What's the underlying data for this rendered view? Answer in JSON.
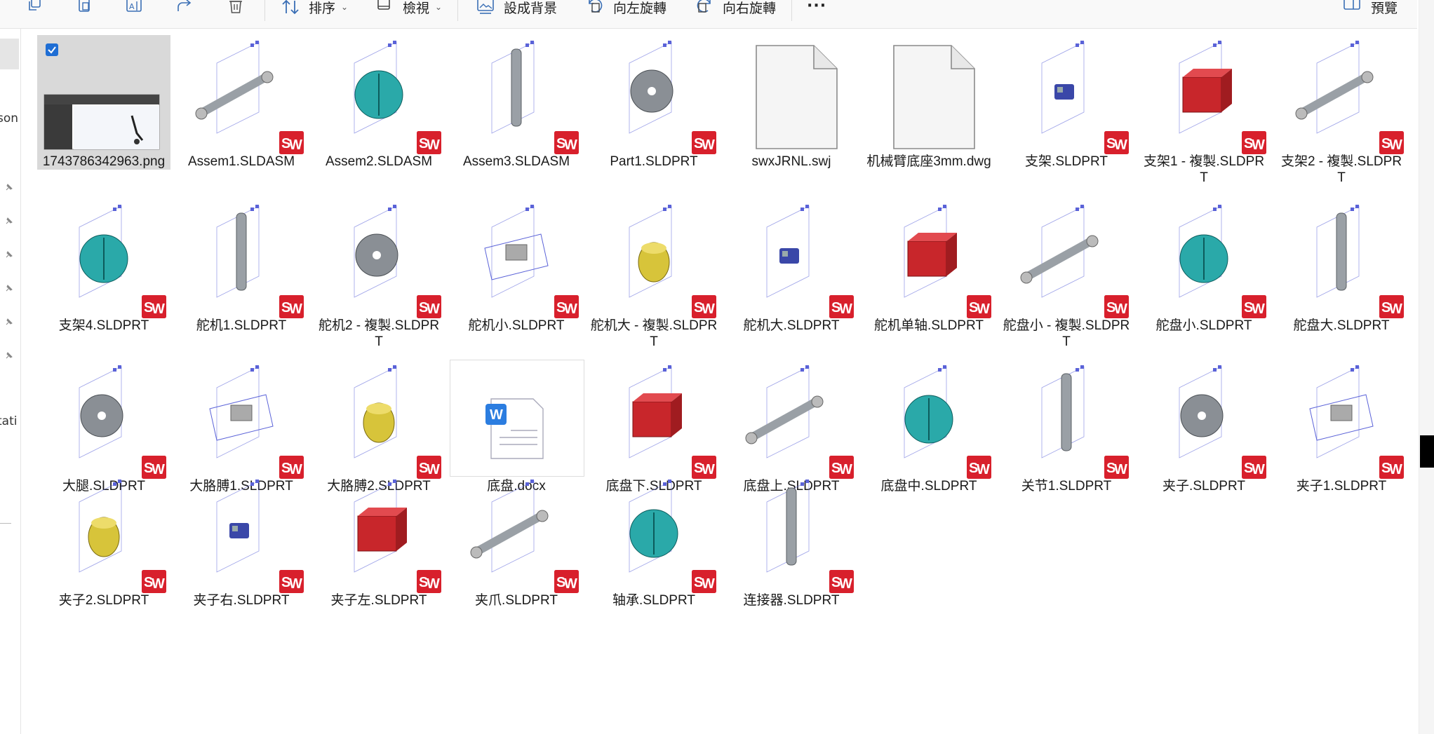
{
  "toolbar": {
    "sort_label": "排序",
    "view_label": "檢視",
    "set_background_label": "設成背景",
    "rotate_left_label": "向左旋轉",
    "rotate_right_label": "向右旋轉",
    "more_label": "···",
    "preview_label": "預覽",
    "icons": [
      "copy-icon",
      "paste-icon",
      "rename-icon",
      "share-icon",
      "delete-icon",
      "sort-icon",
      "view-icon",
      "set-background-icon",
      "rotate-left-icon",
      "rotate-right-icon",
      "more-icon",
      "preview-pane-icon"
    ]
  },
  "sidebar": {
    "partial_labels": [
      "son",
      "tati"
    ]
  },
  "files": [
    {
      "name": "1743786342963.png",
      "icon": "image-thumbnail",
      "selected": true
    },
    {
      "name": "Assem1.SLDASM",
      "icon": "solidworks-assembly"
    },
    {
      "name": "Assem2.SLDASM",
      "icon": "solidworks-assembly"
    },
    {
      "name": "Assem3.SLDASM",
      "icon": "solidworks-assembly"
    },
    {
      "name": "Part1.SLDPRT",
      "icon": "solidworks-part"
    },
    {
      "name": "swxJRNL.swj",
      "icon": "blank-document"
    },
    {
      "name": "机械臂底座3mm.dwg",
      "icon": "blank-document"
    },
    {
      "name": "支架.SLDPRT",
      "icon": "solidworks-part"
    },
    {
      "name": "支架1 - 複製.SLDPRT",
      "icon": "solidworks-part"
    },
    {
      "name": "支架2 - 複製.SLDPRT",
      "icon": "solidworks-part"
    },
    {
      "name": "支架4.SLDPRT",
      "icon": "solidworks-part"
    },
    {
      "name": "舵机1.SLDPRT",
      "icon": "solidworks-part"
    },
    {
      "name": "舵机2 - 複製.SLDPRT",
      "icon": "solidworks-part"
    },
    {
      "name": "舵机小.SLDPRT",
      "icon": "solidworks-part"
    },
    {
      "name": "舵机大 - 複製.SLDPRT",
      "icon": "solidworks-part"
    },
    {
      "name": "舵机大.SLDPRT",
      "icon": "solidworks-part"
    },
    {
      "name": "舵机单轴.SLDPRT",
      "icon": "solidworks-part"
    },
    {
      "name": "舵盘小 - 複製.SLDPRT",
      "icon": "solidworks-part"
    },
    {
      "name": "舵盘小.SLDPRT",
      "icon": "solidworks-part"
    },
    {
      "name": "舵盘大.SLDPRT",
      "icon": "solidworks-part"
    },
    {
      "name": "大腿.SLDPRT",
      "icon": "solidworks-part"
    },
    {
      "name": "大胳膊1.SLDPRT",
      "icon": "solidworks-part"
    },
    {
      "name": "大胳膊2.SLDPRT",
      "icon": "solidworks-part"
    },
    {
      "name": "底盘.docx",
      "icon": "word-document"
    },
    {
      "name": "底盘下.SLDPRT",
      "icon": "solidworks-part"
    },
    {
      "name": "底盘上.SLDPRT",
      "icon": "solidworks-part"
    },
    {
      "name": "底盘中.SLDPRT",
      "icon": "solidworks-part"
    },
    {
      "name": "关节1.SLDPRT",
      "icon": "solidworks-part"
    },
    {
      "name": "夹子.SLDPRT",
      "icon": "solidworks-part"
    },
    {
      "name": "夹子1.SLDPRT",
      "icon": "solidworks-part"
    },
    {
      "name": "夹子2.SLDPRT",
      "icon": "solidworks-part"
    },
    {
      "name": "夹子右.SLDPRT",
      "icon": "solidworks-part"
    },
    {
      "name": "夹子左.SLDPRT",
      "icon": "solidworks-part"
    },
    {
      "name": "夹爪.SLDPRT",
      "icon": "solidworks-part"
    },
    {
      "name": "轴承.SLDPRT",
      "icon": "solidworks-part"
    },
    {
      "name": "连接器.SLDPRT",
      "icon": "solidworks-part"
    }
  ],
  "colors": {
    "accent": "#1f6ed4",
    "solidworks_red": "#d8202c",
    "servo_red": "#c8262b",
    "teal": "#2aa9a9",
    "selection_bg": "#d9d9d9"
  }
}
